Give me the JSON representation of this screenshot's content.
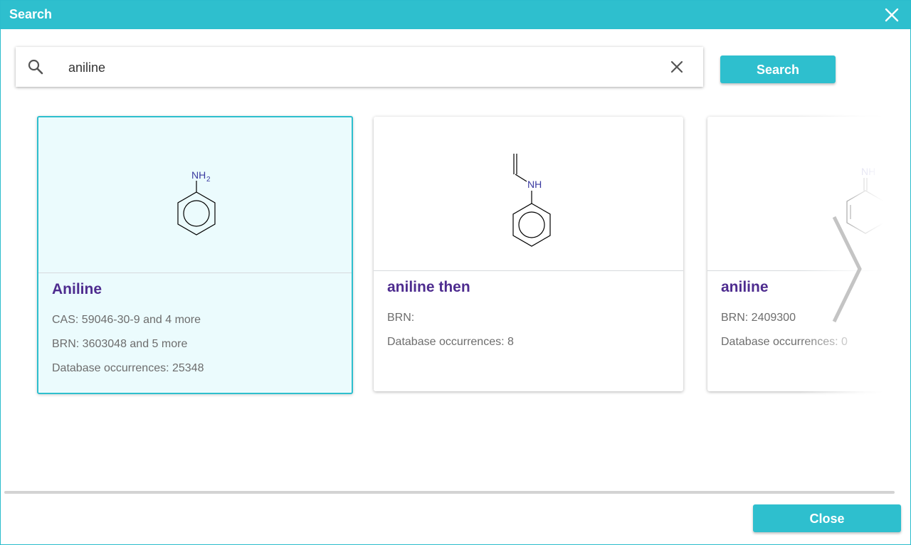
{
  "dialog": {
    "title": "Search"
  },
  "search": {
    "value": "aniline",
    "button_label": "Search"
  },
  "results": [
    {
      "name": "Aniline",
      "structure_label": "NH2",
      "lines": [
        "CAS: 59046-30-9 and 4 more",
        "BRN: 3603048 and 5 more",
        "Database occurrences: 25348"
      ],
      "selected": true
    },
    {
      "name": "aniline then",
      "structure_label": "NH",
      "lines": [
        "BRN:",
        "Database occurrences: 8"
      ],
      "selected": false
    },
    {
      "name": "aniline",
      "structure_label": "NH",
      "lines": [
        "BRN: 2409300",
        "Database occurrences: 0"
      ],
      "selected": false
    }
  ],
  "footer": {
    "close_label": "Close"
  },
  "colors": {
    "accent": "#2ebfce",
    "result_name": "#4e2c8f",
    "atom_label": "#3a3aa0",
    "meta_text": "#6d6d6d"
  },
  "icons": {
    "close": "close-icon",
    "search": "search-icon",
    "clear": "clear-icon",
    "next": "chevron-right-icon"
  }
}
